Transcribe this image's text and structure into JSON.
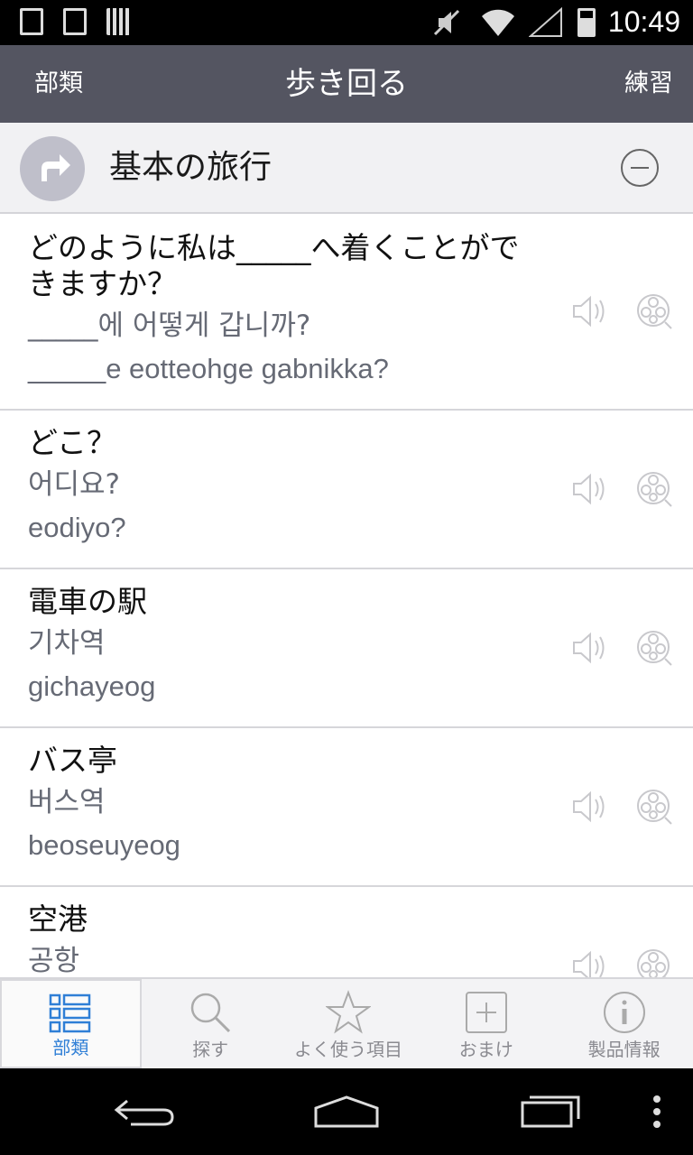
{
  "status_bar": {
    "time": "10:49"
  },
  "title_bar": {
    "left_button": "部類",
    "title": "歩き回る",
    "right_button": "練習"
  },
  "section": {
    "title": "基本の旅行"
  },
  "phrases": [
    {
      "jp": "どのように私は_____へ着くことができますか？",
      "ko": "_____에 어떻게 갑니까?",
      "rom": "_____e eotteohge gabnikka?"
    },
    {
      "jp": "どこ？",
      "ko": "어디요?",
      "rom": "eodiyo?"
    },
    {
      "jp": "電車の駅",
      "ko": "기차역",
      "rom": "gichayeog"
    },
    {
      "jp": "バス亭",
      "ko": "버스역",
      "rom": "beoseuyeog"
    },
    {
      "jp": "空港",
      "ko": "공항",
      "rom": ""
    }
  ],
  "tab_bar": {
    "tabs": [
      {
        "label": "部類",
        "icon": "categories-icon",
        "active": true
      },
      {
        "label": "探す",
        "icon": "search-icon",
        "active": false
      },
      {
        "label": "よく使う項目",
        "icon": "star-icon",
        "active": false
      },
      {
        "label": "おまけ",
        "icon": "plus-icon",
        "active": false
      },
      {
        "label": "製品情報",
        "icon": "info-icon",
        "active": false
      }
    ]
  },
  "colors": {
    "title_bar_bg": "#545561",
    "active_tab": "#2f7fd6"
  }
}
